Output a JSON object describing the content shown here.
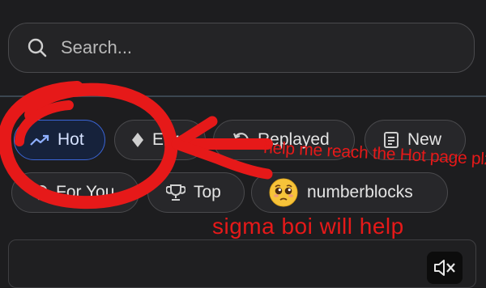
{
  "search": {
    "placeholder": "Search..."
  },
  "filters": [
    {
      "label": "Hot",
      "icon": "trending-up-icon",
      "active": true
    },
    {
      "label": "Earn",
      "icon": "diamond-icon",
      "active": false
    },
    {
      "label": "Replayed",
      "icon": "replay-icon",
      "active": false
    },
    {
      "label": "New",
      "icon": "news-icon",
      "active": false
    },
    {
      "label": "For You",
      "icon": "heart-icon",
      "active": false
    },
    {
      "label": "Top",
      "icon": "trophy-icon",
      "active": false
    },
    {
      "label": "numberblocks",
      "icon": "pleading-face-emoji",
      "active": false
    }
  ],
  "annotations": {
    "text1": "help me reach the Hot page plzz",
    "text2": "sigma boi will help",
    "color": "#e61919"
  },
  "media": {
    "mute_icon": "mute-icon"
  },
  "colors": {
    "background": "#1d1d1f",
    "active_chip": "#16223b",
    "active_border": "#3b65d6"
  }
}
